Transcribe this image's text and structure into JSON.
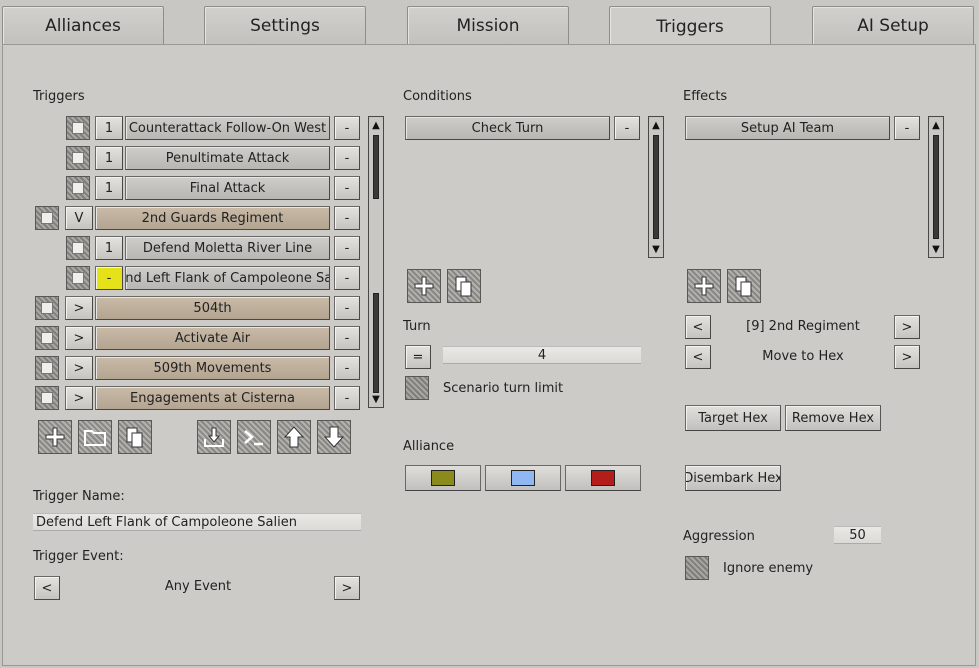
{
  "tabs": [
    "Alliances",
    "Settings",
    "Mission",
    "Triggers",
    "AI Setup"
  ],
  "active_tab": "Triggers",
  "triggers": {
    "heading": "Triggers",
    "rows": [
      {
        "toggle": "1",
        "label": "Counterattack Follow-On West",
        "group": false,
        "indent": true
      },
      {
        "toggle": "1",
        "label": "Penultimate Attack",
        "group": false,
        "indent": true
      },
      {
        "toggle": "1",
        "label": "Final Attack",
        "group": false,
        "indent": true
      },
      {
        "toggle": "V",
        "label": "2nd Guards Regiment",
        "group": true,
        "indent": false
      },
      {
        "toggle": "1",
        "label": "Defend Moletta River Line",
        "group": false,
        "indent": true
      },
      {
        "toggle": "-",
        "label": "Defend Left Flank of Campoleone Salien-",
        "group": false,
        "indent": true,
        "highlight": true
      },
      {
        "toggle": ">",
        "label": "504th",
        "group": true,
        "indent": false
      },
      {
        "toggle": ">",
        "label": "Activate Air",
        "group": true,
        "indent": false
      },
      {
        "toggle": ">",
        "label": "509th Movements",
        "group": true,
        "indent": false
      },
      {
        "toggle": ">",
        "label": "Engagements at Cisterna",
        "group": true,
        "indent": false
      }
    ],
    "remove_label": "-",
    "name_label": "Trigger Name:",
    "name_value": "Defend Left Flank of Campoleone Salien",
    "event_label": "Trigger Event:",
    "event_value": "Any Event",
    "prev": "<",
    "next": ">"
  },
  "conditions": {
    "heading": "Conditions",
    "items": [
      "Check Turn"
    ],
    "remove_label": "-",
    "turn_label": "Turn",
    "turn_op": "=",
    "turn_value": "4",
    "scenario_limit": "Scenario turn limit",
    "alliance_label": "Alliance",
    "alliance_colors": [
      "#8b8a1c",
      "#8fb8f2",
      "#b31e1a"
    ]
  },
  "effects": {
    "heading": "Effects",
    "items": [
      "Setup AI Team"
    ],
    "remove_label": "-",
    "team_value": "[9] 2nd Regiment",
    "action_value": "Move to Hex",
    "prev": "<",
    "next": ">",
    "target_hex": "Target Hex",
    "remove_hex": "Remove Hex",
    "disembark_hex": "Disembark Hex",
    "aggression_label": "Aggression",
    "aggression_value": "50",
    "ignore_enemy": "Ignore enemy"
  },
  "colors": {
    "highlight": "#e6e21a",
    "group_button": "#c2b49f"
  }
}
